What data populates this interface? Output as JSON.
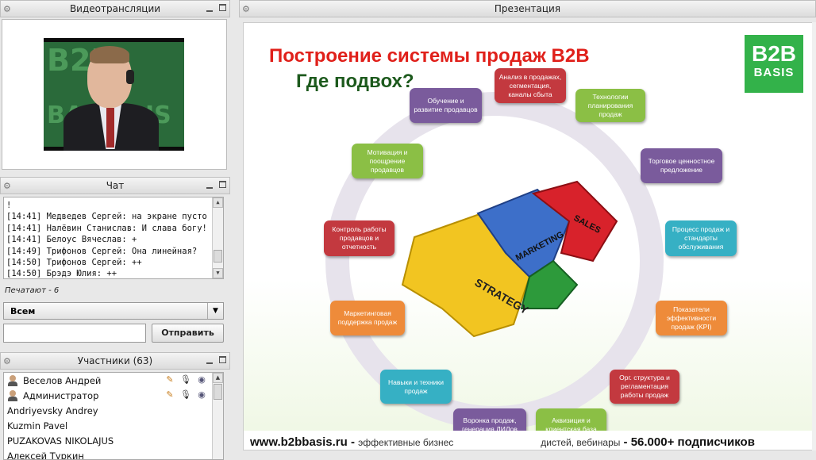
{
  "video_panel": {
    "title": "Видеотрансляции",
    "watermark": "B2B BASIS"
  },
  "chat_panel": {
    "title": "Чат",
    "messages": [
      "!",
      "[14:41] Медведев Сергей: на экране пусто",
      "[14:41] Налёвин Станислав: И слава богу!",
      "[14:41] Белоус Вячеслав: +",
      "[14:49] Трифонов Сергей: Она линейная?",
      "[14:50] Трифонов Сергей: ++",
      "[14:50] Брэдэ Юлия: ++"
    ],
    "typing_status": "Печатают - 6",
    "recipient": "Всем",
    "message_placeholder": "",
    "send_label": "Отправить"
  },
  "users_panel": {
    "title": "Участники (63)",
    "users": [
      {
        "name": "Веселов Андрей",
        "has_avatar": true,
        "has_tools": true
      },
      {
        "name": "Администратор",
        "has_avatar": true,
        "has_tools": true
      },
      {
        "name": "Andriyevsky Andrey",
        "has_avatar": false,
        "has_tools": false
      },
      {
        "name": "Kuzmin Pavel",
        "has_avatar": false,
        "has_tools": false
      },
      {
        "name": "PUZAKOVAS NIKOLAJUS",
        "has_avatar": false,
        "has_tools": false
      },
      {
        "name": "Алексей Туркин",
        "has_avatar": false,
        "has_tools": false
      }
    ]
  },
  "presentation_panel": {
    "title": "Презентация",
    "slide": {
      "title": "Построение системы продаж B2B",
      "subtitle": "Где подвох?",
      "brand_top": "B2B",
      "brand_bottom": "BASIS",
      "puzzle_labels": [
        "STRATEGY",
        "MARKETING",
        "SALES"
      ],
      "boxes": [
        {
          "text": "Анализ в продажах, сегментация, каналы сбыта",
          "color": "red"
        },
        {
          "text": "Технологии планирования продаж",
          "color": "green"
        },
        {
          "text": "Торговое ценностное предложение",
          "color": "purple"
        },
        {
          "text": "Процесс продаж и стандарты обслуживания",
          "color": "teal"
        },
        {
          "text": "Показатели эффективности продаж (KPI)",
          "color": "orange"
        },
        {
          "text": "Орг. структура и регламентация работы продаж",
          "color": "red"
        },
        {
          "text": "Аквизиция и клиентская база",
          "color": "green"
        },
        {
          "text": "Воронка продаж, генерация ЛИДов",
          "color": "purple"
        },
        {
          "text": "Навыки и техники продаж",
          "color": "teal"
        },
        {
          "text": "Маркетинговая поддержка продаж",
          "color": "orange"
        },
        {
          "text": "Контроль работы продавцов и отчетность",
          "color": "red"
        },
        {
          "text": "Мотивация и поощрение продавцов",
          "color": "green"
        },
        {
          "text": "Обучение и развитие продавцов",
          "color": "purple"
        }
      ],
      "footer": {
        "site": "www.b2bbasis.ru",
        "sep": " - ",
        "middle": "эффективные бизнес",
        "middle2": "дистей, вебинары",
        "right": " - 56.000+ подписчиков"
      }
    }
  },
  "colors": {
    "red": "#c3393f",
    "green": "#8bbf45",
    "purple": "#7a5b9c",
    "teal": "#36b0c4",
    "orange": "#ee8b3a",
    "title_red": "#e0201a",
    "subtitle_green": "#1d5a1d",
    "brand_green": "#33b24a"
  }
}
